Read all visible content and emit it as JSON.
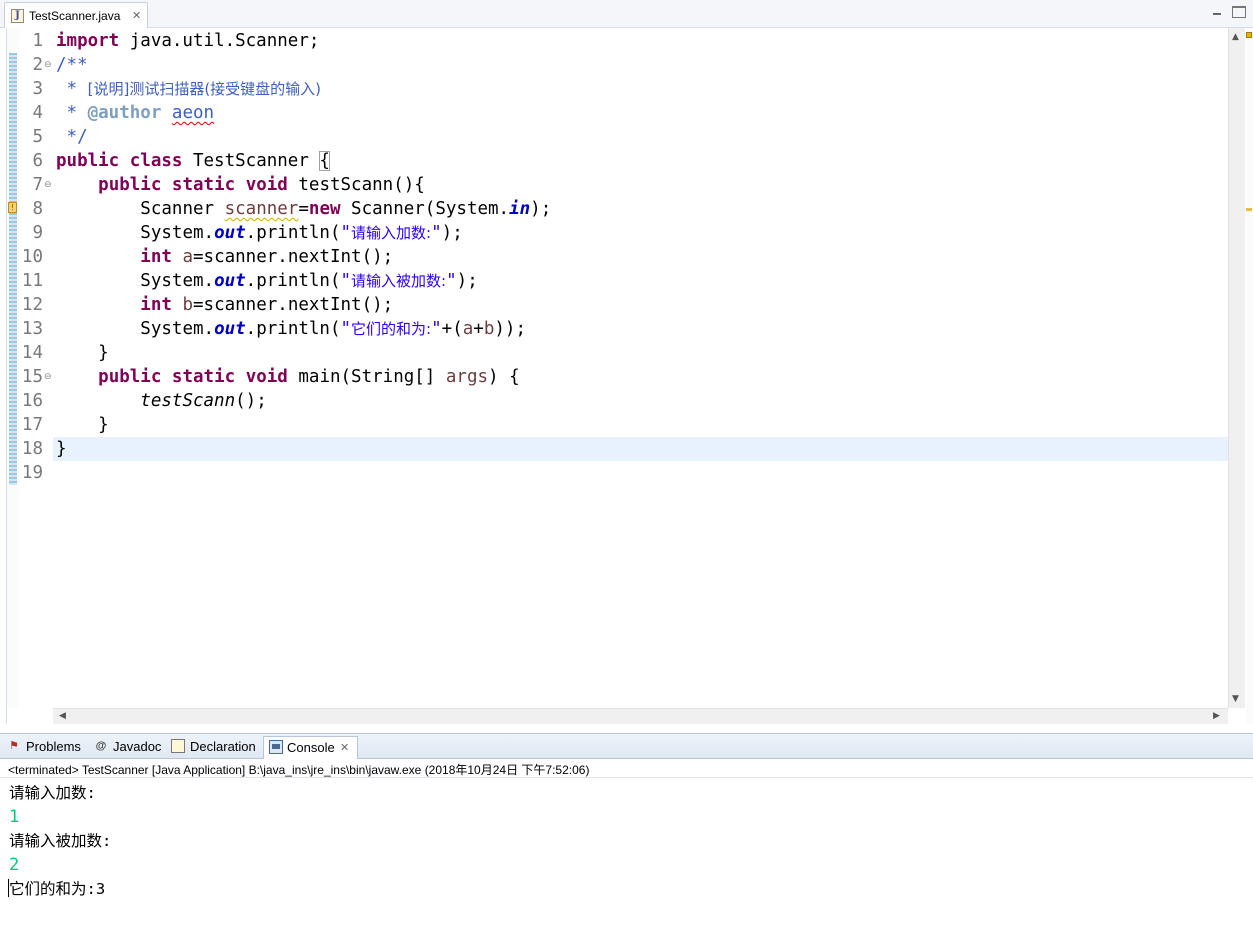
{
  "editor_tab": {
    "title": "TestScanner.java",
    "close_glyph": "✕"
  },
  "window_controls": {
    "minimize_icon": "minimize-icon",
    "maximize_icon": "maximize-icon"
  },
  "editor": {
    "line_numbers": [
      "1",
      "2",
      "3",
      "4",
      "5",
      "6",
      "7",
      "8",
      "9",
      "10",
      "11",
      "12",
      "13",
      "14",
      "15",
      "16",
      "17",
      "18",
      "19"
    ],
    "fold_markers": [
      "2",
      "7",
      "15"
    ],
    "current_line": "18",
    "warning_line": "8",
    "code": {
      "l1": {
        "k_import": "import",
        "rest": " java.util.Scanner;"
      },
      "l2": {
        "c": "/**"
      },
      "l3": {
        "star": " * ",
        "desc": "[说明]测试扫描器(接受键盘的输入)"
      },
      "l4": {
        "star": " * ",
        "tag": "@author",
        "sp": " ",
        "name": "aeon"
      },
      "l5": {
        "c": " */"
      },
      "l6": {
        "k_public": "public",
        "k_class": "class",
        "name": " TestScanner ",
        "brace": "{"
      },
      "l7": {
        "indent": "    ",
        "k_public": "public",
        "k_static": "static",
        "k_void": "void",
        "rest": " testScann(){"
      },
      "l8": {
        "indent": "        ",
        "t": "Scanner ",
        "v": "scanner",
        "eq": "=",
        "k_new": "new",
        "t2": " Scanner(System.",
        "f": "in",
        "end": ");"
      },
      "l9": {
        "indent": "        ",
        "a": "System.",
        "f": "out",
        "b": ".println(",
        "q1": "\"",
        "s": "请输入加数:",
        "q2": "\"",
        "end": ");"
      },
      "l10": {
        "indent": "        ",
        "k_int": "int",
        "a": " ",
        "v": "a",
        "rest": "=scanner.nextInt();"
      },
      "l11": {
        "indent": "        ",
        "a": "System.",
        "f": "out",
        "b": ".println(",
        "q1": "\"",
        "s": "请输入被加数:",
        "q2": "\"",
        "end": ");"
      },
      "l12": {
        "indent": "        ",
        "k_int": "int",
        "a": " ",
        "v": "b",
        "rest": "=scanner.nextInt();"
      },
      "l13": {
        "indent": "        ",
        "a": "System.",
        "f": "out",
        "b": ".println(",
        "q1": "\"",
        "s": "它们的和为:",
        "q2": "\"",
        "plus": "+(",
        "va": "a",
        "p": "+",
        "vb": "b",
        "end": "));"
      },
      "l14": {
        "c": "    }"
      },
      "l15": {
        "indent": "    ",
        "k_public": "public",
        "k_static": "static",
        "k_void": "void",
        "m": " main(String[] ",
        "v": "args",
        "end": ") {"
      },
      "l16": {
        "indent": "        ",
        "call": "testScann",
        "end": "();"
      },
      "l17": {
        "c": "    }"
      },
      "l18": {
        "c": "}"
      }
    }
  },
  "views": {
    "tabs": [
      {
        "label": "Problems",
        "icon": "problems-icon"
      },
      {
        "label": "Javadoc",
        "icon": "javadoc-icon",
        "glyph": "@"
      },
      {
        "label": "Declaration",
        "icon": "declaration-icon"
      },
      {
        "label": "Console",
        "icon": "console-icon",
        "active": true
      }
    ],
    "active_close_glyph": "✕"
  },
  "console": {
    "status": "<terminated> TestScanner [Java Application] B:\\java_ins\\jre_ins\\bin\\javaw.exe (2018年10月24日 下午7:52:06)",
    "lines": [
      {
        "text": "请输入加数:",
        "kind": "output"
      },
      {
        "text": "1",
        "kind": "input"
      },
      {
        "text": "请输入被加数:",
        "kind": "output"
      },
      {
        "text": "2",
        "kind": "input"
      },
      {
        "text": "它们的和为:3",
        "kind": "output"
      }
    ],
    "input_color": "#00c87d"
  },
  "colors": {
    "keyword": "#7f0055",
    "comment": "#3f5fbf",
    "string": "#2a00ff",
    "field": "#0000c0",
    "current_line_bg": "#e8f2fe"
  }
}
